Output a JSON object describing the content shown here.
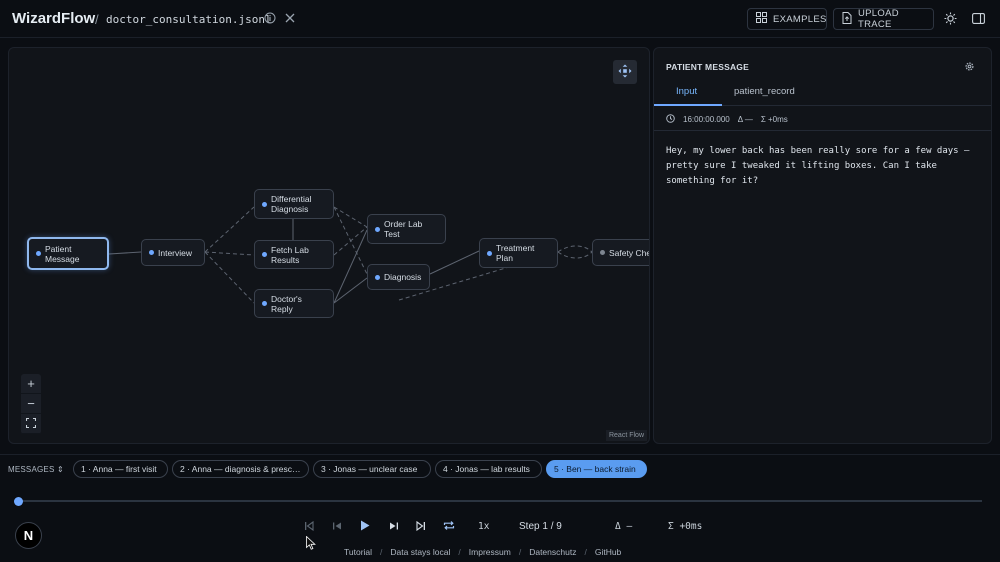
{
  "header": {
    "brand": "WizardFlow",
    "separator": "/",
    "file_name": "doctor_consultation.jsonl",
    "examples_label": "EXAMPLES",
    "upload_label": "UPLOAD TRACE"
  },
  "graph": {
    "nodes": [
      {
        "id": "patient-message",
        "label": "Patient\nMessage"
      },
      {
        "id": "interview",
        "label": "Interview"
      },
      {
        "id": "differential-diagnosis",
        "label": "Differential\nDiagnosis"
      },
      {
        "id": "fetch-lab-results",
        "label": "Fetch Lab\nResults"
      },
      {
        "id": "doctors-reply",
        "label": "Doctor's\nReply"
      },
      {
        "id": "order-lab-test",
        "label": "Order Lab\nTest"
      },
      {
        "id": "diagnosis",
        "label": "Diagnosis"
      },
      {
        "id": "treatment-plan",
        "label": "Treatment\nPlan"
      },
      {
        "id": "safety-check",
        "label": "Safety Che"
      }
    ],
    "attribution": "React Flow",
    "zoom_in": "+",
    "zoom_out": "−"
  },
  "panel": {
    "title": "PATIENT MESSAGE",
    "tabs": [
      "Input",
      "patient_record"
    ],
    "active_tab": "Input",
    "timestamp": "16:00:00.000",
    "delta": "Δ —",
    "sum": "Σ +0ms",
    "message": "Hey, my lower back has been really sore for a few days — pretty sure I tweaked it lifting boxes. Can I take something for it?"
  },
  "messages": {
    "label": "MESSAGES",
    "items": [
      "1 · Anna — first visit",
      "2 · Anna — diagnosis & presc…",
      "3 · Jonas — unclear case",
      "4 · Jonas — lab results",
      "5 · Ben — back strain"
    ],
    "active_index": 4
  },
  "playback": {
    "progress": 0,
    "rate": "1x",
    "step": "Step 1 / 9",
    "delta": "Δ —",
    "sum": "Σ +0ms",
    "avatar_letter": "N"
  },
  "footer": {
    "links": [
      "Tutorial",
      "Data stays local",
      "Impressum",
      "Datenschutz",
      "GitHub"
    ],
    "separator": "/"
  },
  "colors": {
    "accent": "#6fa8ff",
    "background": "#0b0e13",
    "panel": "#111419",
    "chip_active": "#5a9cf0"
  },
  "icons": [
    "info-icon",
    "close-icon",
    "grid-icon",
    "upload-icon",
    "sun-icon",
    "sidebar-icon",
    "fit-view-icon",
    "gear-icon",
    "clock-icon",
    "skip-start-icon",
    "step-back-icon",
    "play-icon",
    "step-forward-icon",
    "skip-end-icon",
    "loop-icon"
  ]
}
